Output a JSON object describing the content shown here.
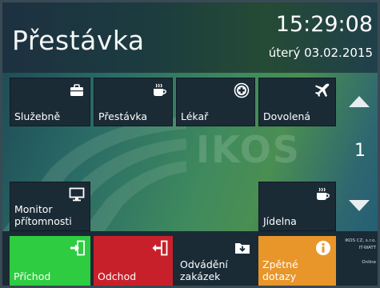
{
  "header": {
    "status_title": "Přestávka",
    "time": "15:29:08",
    "date": "úterý 03.02.2015"
  },
  "tiles": {
    "sluzebne": "Služebně",
    "prestavka": "Přestávka",
    "lekar": "Lékař",
    "dovolena": "Dovolená",
    "monitor_line1": "Monitor",
    "monitor_line2": "přítomnosti",
    "jidelna": "Jídelna"
  },
  "watermark": "IKOS",
  "pagination": {
    "page": "1"
  },
  "bottom": {
    "prichod": "Příchod",
    "odchod": "Odchod",
    "odvadeni_line1": "Odvádění",
    "odvadeni_line2": "zakázek",
    "zpetne_line1": "Zpětné",
    "zpetne_line2": "dotazy"
  },
  "company": {
    "name": "IKOS CZ, s.r.o.",
    "product": "IT-WATT",
    "status": "Online"
  },
  "colors": {
    "tile_dark": "#1a2b36",
    "prichod_green": "#2ecc40",
    "odchod_red": "#c8202a",
    "zpetne_orange": "#e8952a"
  }
}
